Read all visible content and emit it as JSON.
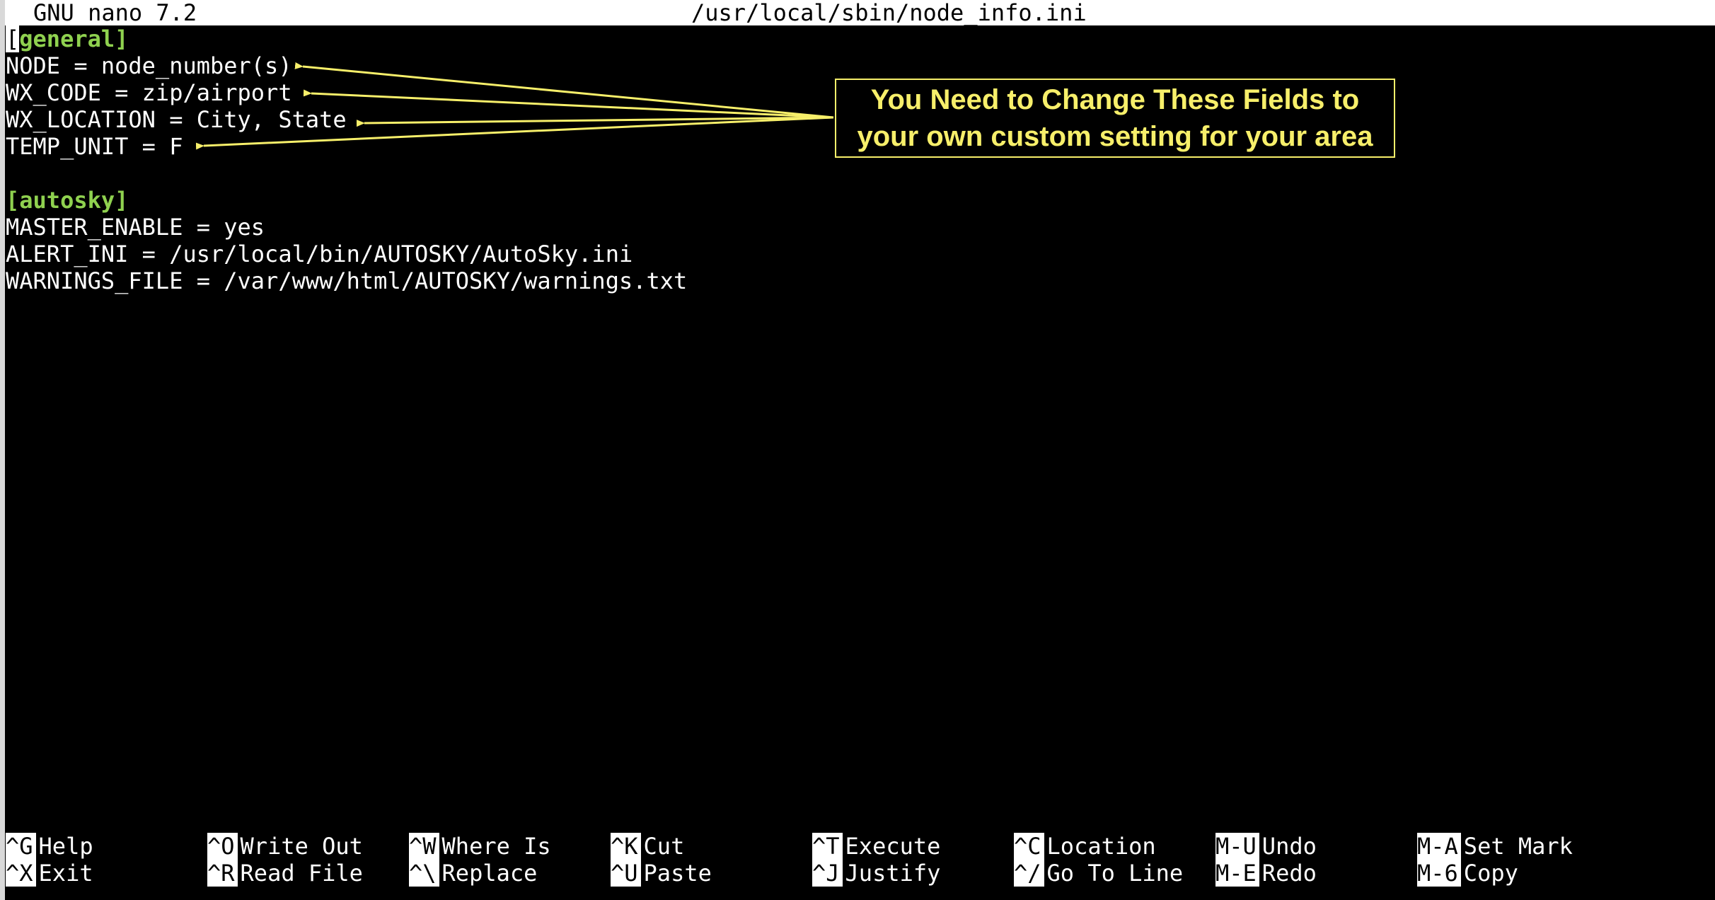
{
  "title_bar": {
    "app": "GNU nano 7.2",
    "file_path": "/usr/local/sbin/node_info.ini"
  },
  "editor": {
    "cursor_char": "[",
    "general_header_rest": "general]",
    "general_lines": [
      "NODE = node_number(s)",
      "WX_CODE = zip/airport",
      "WX_LOCATION = City, State",
      "TEMP_UNIT = F"
    ],
    "autosky_header": "[autosky]",
    "autosky_lines": [
      "MASTER_ENABLE = yes",
      "ALERT_INI = /usr/local/bin/AUTOSKY/AutoSky.ini",
      "WARNINGS_FILE = /var/www/html/AUTOSKY/warnings.txt"
    ]
  },
  "callout": {
    "line1": "You Need to Change These Fields to",
    "line2": "your own custom setting for your area",
    "color": "#f7ef6a"
  },
  "colors": {
    "section_header": "#8fd14f",
    "background": "#000000",
    "text": "#ffffff"
  },
  "shortcuts": {
    "row1": [
      {
        "key": "^G",
        "label": "Help"
      },
      {
        "key": "^O",
        "label": "Write Out"
      },
      {
        "key": "^W",
        "label": "Where Is"
      },
      {
        "key": "^K",
        "label": "Cut"
      },
      {
        "key": "^T",
        "label": "Execute"
      },
      {
        "key": "^C",
        "label": "Location"
      },
      {
        "key": "M-U",
        "label": "Undo"
      },
      {
        "key": "M-A",
        "label": "Set Mark"
      }
    ],
    "row2": [
      {
        "key": "^X",
        "label": "Exit"
      },
      {
        "key": "^R",
        "label": "Read File"
      },
      {
        "key": "^\\",
        "label": "Replace"
      },
      {
        "key": "^U",
        "label": "Paste"
      },
      {
        "key": "^J",
        "label": "Justify"
      },
      {
        "key": "^/",
        "label": "Go To Line"
      },
      {
        "key": "M-E",
        "label": "Redo"
      },
      {
        "key": "M-6",
        "label": "Copy"
      }
    ]
  }
}
